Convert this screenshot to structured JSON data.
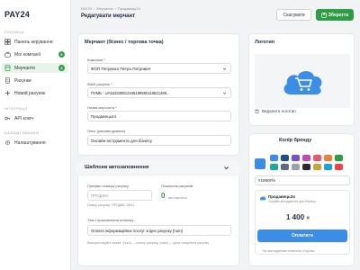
{
  "sidebar": {
    "logo": "PAY24",
    "sections": {
      "main": "ГОЛОВНА",
      "integrations": "ІНТЕГРАЦІЇ",
      "settings": "НАЛАШТУВАННЯ"
    },
    "items": [
      {
        "label": "Панель керування",
        "icon": "grid-icon"
      },
      {
        "label": "Мої компанії",
        "icon": "briefcase-icon",
        "badge": "6"
      },
      {
        "label": "Мерчанти",
        "icon": "store-icon",
        "badge": "8",
        "active": true
      },
      {
        "label": "Рахунки",
        "icon": "document-icon"
      },
      {
        "label": "Новий рахунок",
        "icon": "plus-icon"
      },
      {
        "label": "API ключ",
        "icon": "key-icon"
      },
      {
        "label": "Налаштування",
        "icon": "gear-icon"
      }
    ]
  },
  "header": {
    "breadcrumb": [
      "PAY24",
      "›",
      "Мерчанти",
      "›",
      "Продавець24"
    ],
    "title": "Редагувати мерчант",
    "cancel_label": "Скасувати",
    "save_label": "Зберегти"
  },
  "merchant_card": {
    "title": "Мерчант (бізнес / торгова точка)",
    "company_label": "Компанія *",
    "company_value": "ФОП Петренко Петро Петрович",
    "iban_label": "IBAN рахунок *",
    "iban_value": "ПУМБ - UA543348512345199560118621469...",
    "name_label": "Назва мерчанта *",
    "name_value": "Продавець24",
    "description_label": "Опис (рекомендовано)",
    "description_value": "Онлайн-інструменти для бізнесу"
  },
  "template_card": {
    "title": "Шаблони автозаповнення",
    "prefix_label": "Префікс номера рахунку",
    "prefix_placeholder": "ПРОДЖС",
    "prefix_hint": "Номер рахунку: ПРОДЖС-0001",
    "counter_label": "Лічильник рахунків",
    "counter_value": "0",
    "counter_suffix": "виставлено",
    "purpose_label": "Текст призначення платежу",
    "purpose_value": "Оплата інформаційних послуг згідно рахунку {num}",
    "purpose_hint": "Використовуйте змінні: {num} — номер рахунку, {date} — дата створення рахунку"
  },
  "logo_card": {
    "title": "Логотип",
    "delete_label": "Видалити логотип"
  },
  "brand_card": {
    "title": "Колір бренду",
    "selected_color": "#3c8de6",
    "hex_value": "#1890Ffe",
    "palette": [
      "#3c8de6",
      "#1f4e8a",
      "#7b4fc9",
      "#b84fb0",
      "#e25a6f",
      "#e8833a",
      "#2e9b45",
      "#22a6a0",
      "#5a6b7d",
      "#9aa3ad",
      "#2a2a2a",
      "#c8a33a",
      "#1ea1d4",
      "#e8454a"
    ],
    "preview": {
      "merchant_name": "Продавець24",
      "merchant_desc": "Онлайн-інструменти для бізнесу",
      "amount": "1 400",
      "currency": "₴",
      "pay_label": "Оплатити",
      "footer": "Так виглядатиме платіжна сторінка"
    }
  },
  "colors": {
    "accent": "#2e9b45",
    "brand_blue": "#3c8de6"
  }
}
